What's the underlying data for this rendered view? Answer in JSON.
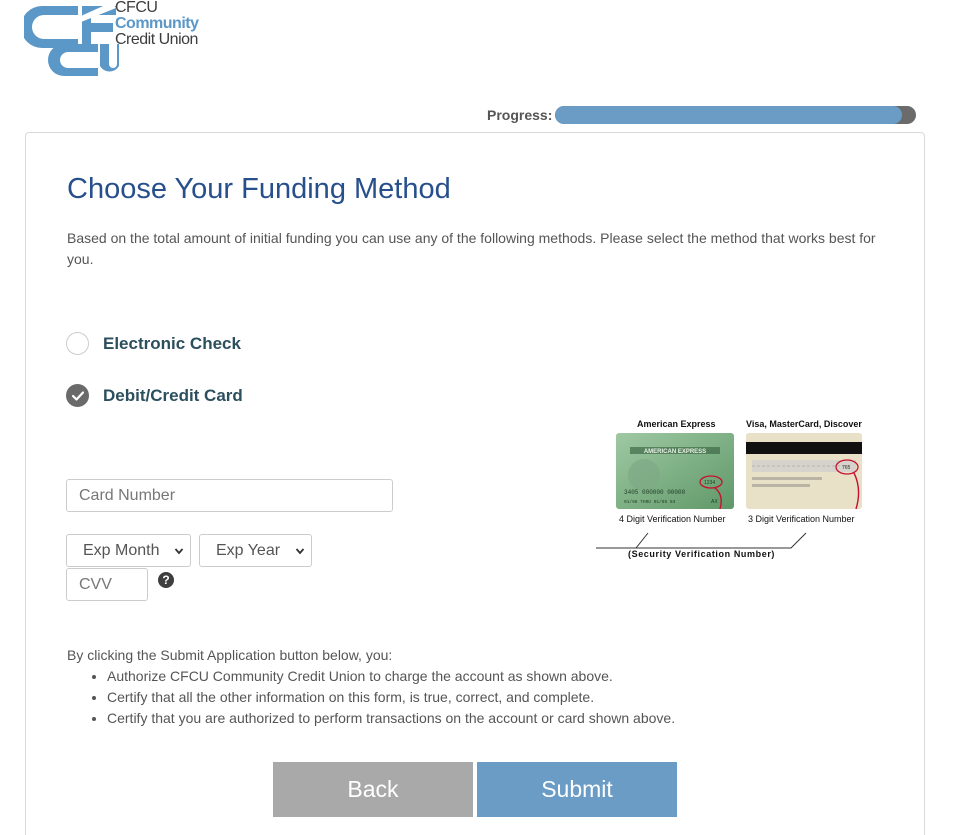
{
  "logo": {
    "line1": "CFCU",
    "line2": "Community",
    "line3": "Credit Union",
    "icon": "cfcu-logo-mark",
    "colors": {
      "brand_blue": "#5b97c7"
    }
  },
  "progress": {
    "label": "Progress:",
    "value": 0.96
  },
  "form": {
    "title": "Choose Your Funding Method",
    "intro": "Based on the total amount of initial funding you can use any of the following methods. Please select the method that works best for you.",
    "options": [
      {
        "label": "Electronic Check",
        "selected": false
      },
      {
        "label": "Debit/Credit Card",
        "selected": true
      }
    ],
    "card_number": {
      "placeholder": "Card Number",
      "value": ""
    },
    "exp_month": {
      "selected": "Exp Month"
    },
    "exp_year": {
      "selected": "Exp Year"
    },
    "cvv": {
      "placeholder": "CVV",
      "value": ""
    },
    "help_icon": "question-circle-icon"
  },
  "card_illustration": {
    "amex_caption": "American Express",
    "visa_caption": "Visa, MasterCard, Discover",
    "amex_sub": "4 Digit Verification Number",
    "visa_sub": "3 Digit Verification Number",
    "svn": "(Security Verification Number)",
    "amex_code": "1234",
    "visa_code": "765",
    "amex_brand": "AMERICAN EXPRESS",
    "amex_number": "3405 000000 00000",
    "amex_expiry": "01/98 THRU 01/05 03",
    "amex_id": "AX"
  },
  "terms": {
    "intro": "By clicking the Submit Application button below, you:",
    "items": [
      "Authorize CFCU Community Credit Union to charge the account as shown above.",
      "Certify that all the other information on this form, is true, correct, and complete.",
      "Certify that you are authorized to perform transactions on the account or card shown above."
    ]
  },
  "buttons": {
    "back": "Back",
    "submit": "Submit"
  }
}
